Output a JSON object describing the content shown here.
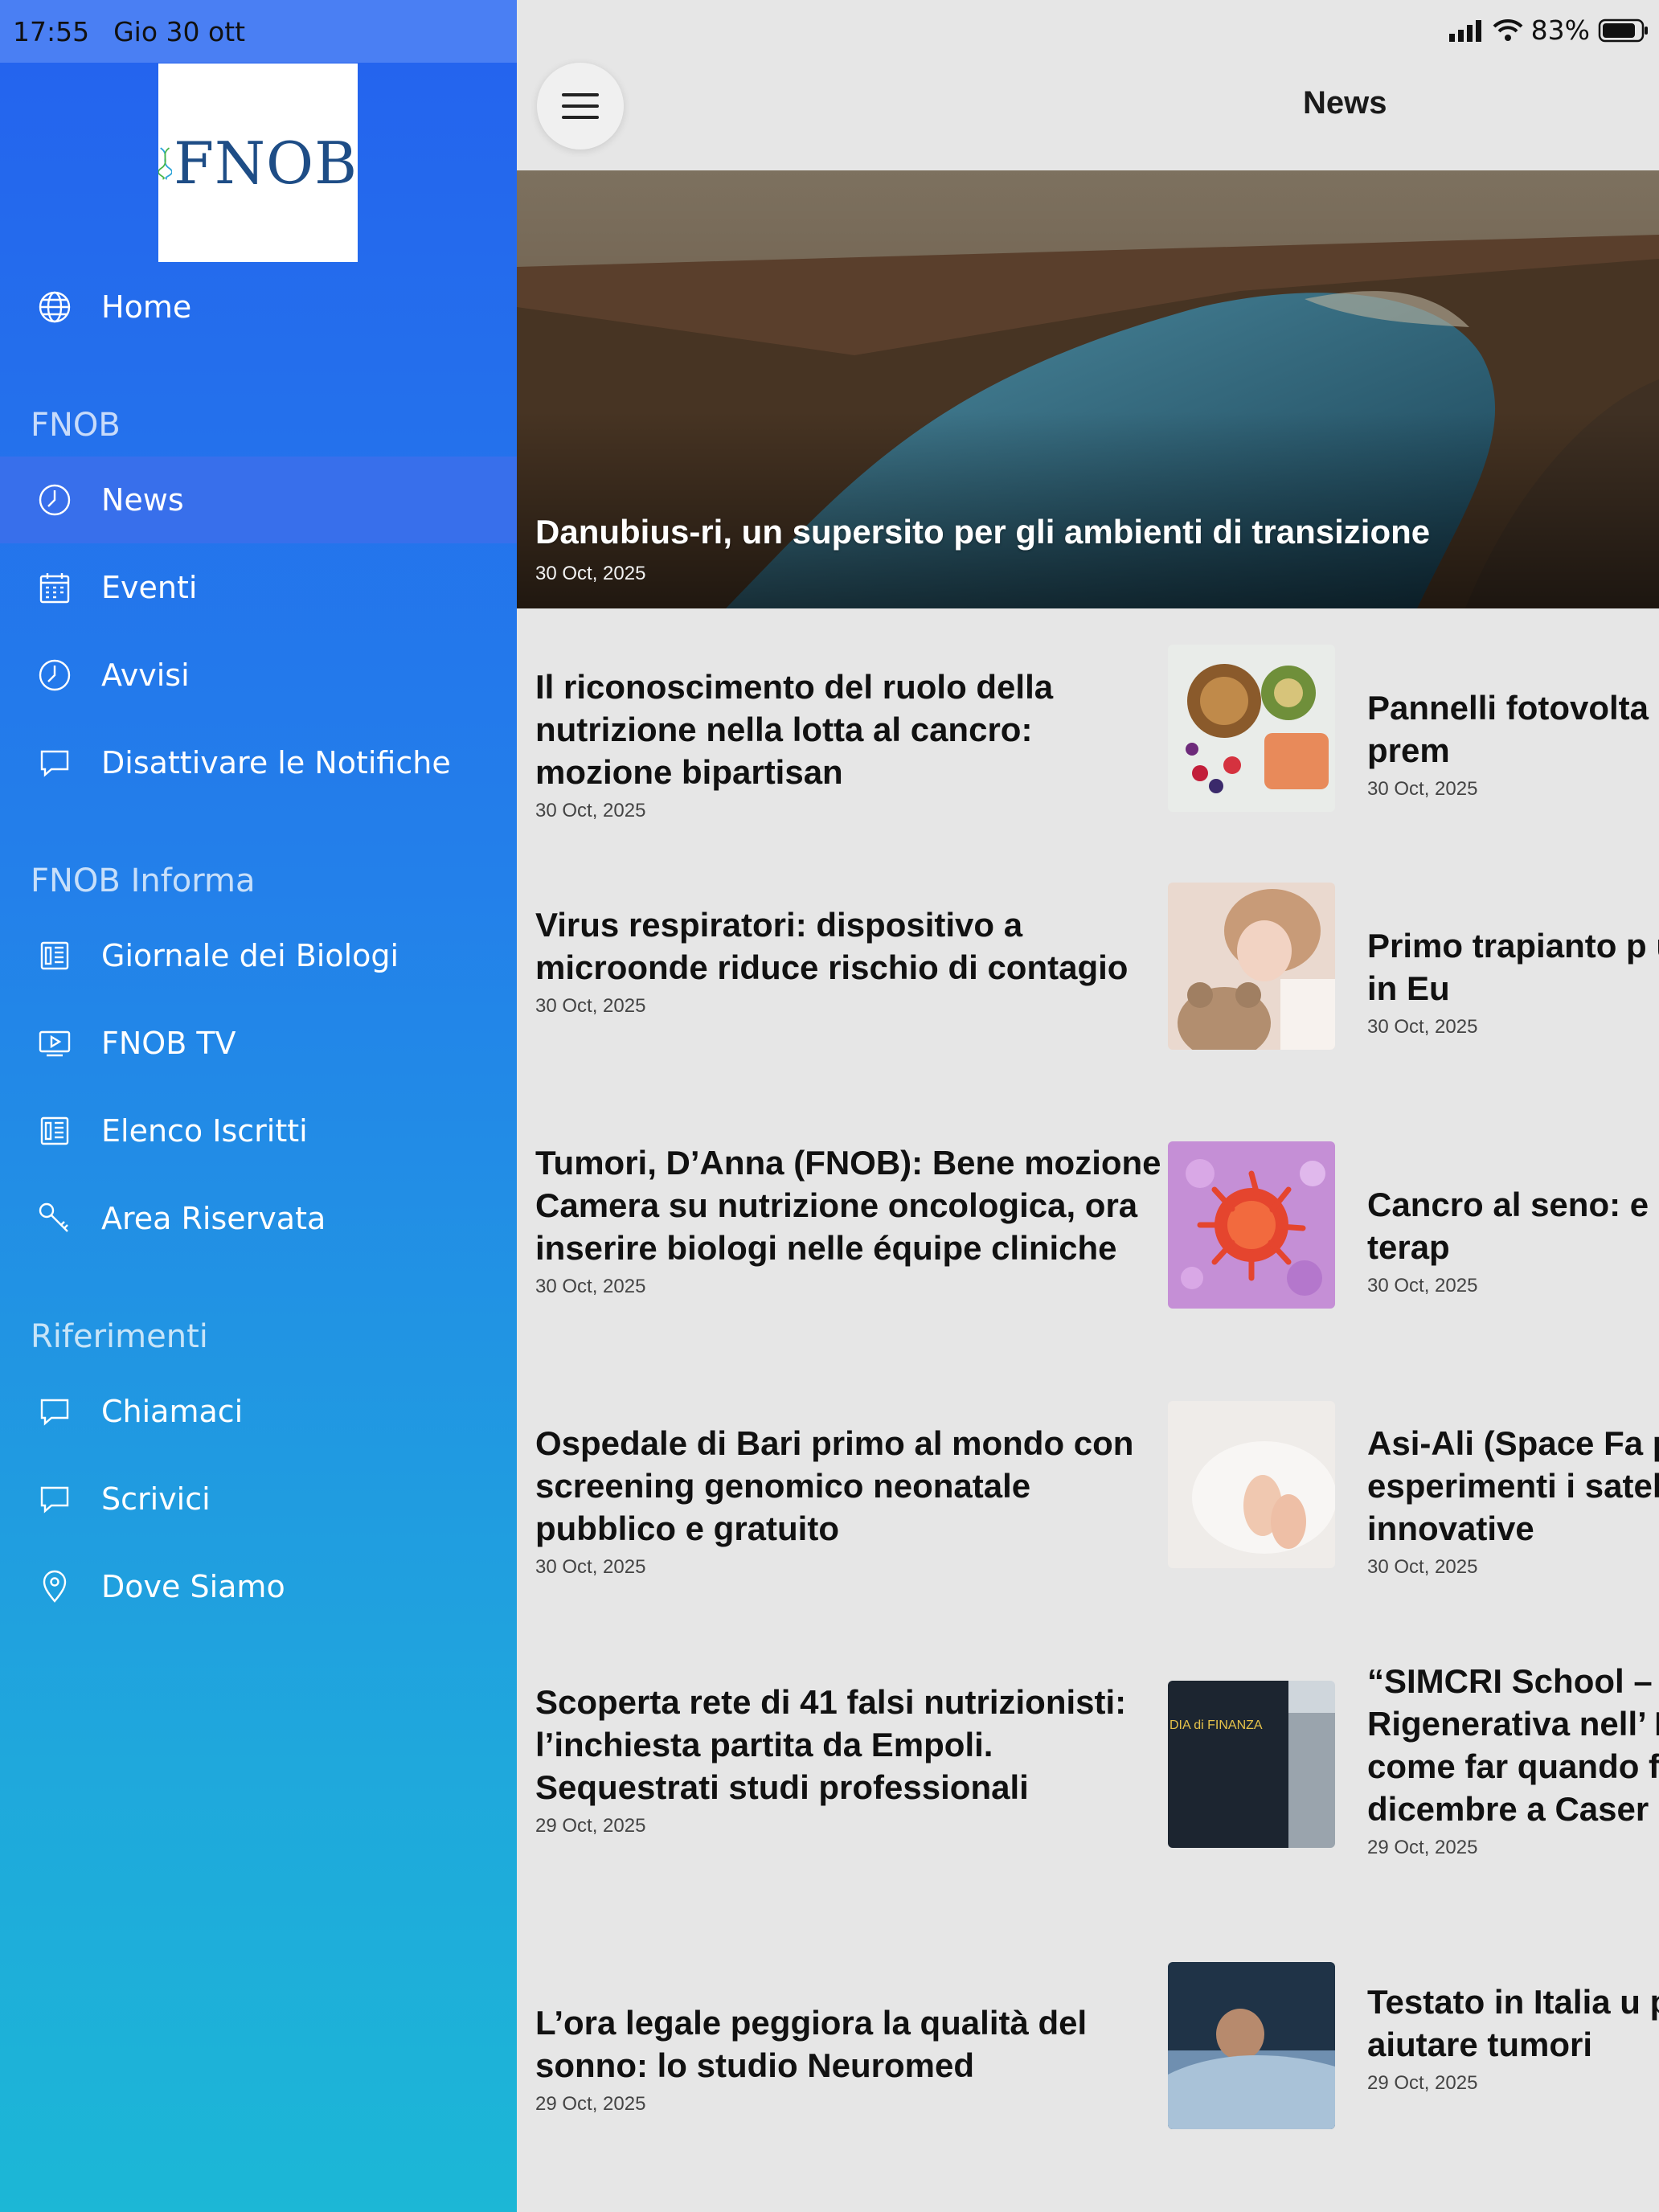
{
  "status": {
    "time": "17:55",
    "date": "Gio 30 ott",
    "battery": "83%"
  },
  "brand": {
    "logo_text": "FNOB"
  },
  "sidebar": {
    "home": "Home",
    "sections": [
      {
        "header": "FNOB",
        "items": [
          {
            "label": "News",
            "icon": "clock-icon",
            "active": true
          },
          {
            "label": "Eventi",
            "icon": "calendar-icon"
          },
          {
            "label": "Avvisi",
            "icon": "clock-icon"
          },
          {
            "label": "Disattivare le Notifiche",
            "icon": "chat-bubble-icon"
          }
        ]
      },
      {
        "header": "FNOB Informa",
        "items": [
          {
            "label": "Giornale dei Biologi",
            "icon": "newspaper-icon"
          },
          {
            "label": "FNOB TV",
            "icon": "tv-icon"
          },
          {
            "label": "Elenco Iscritti",
            "icon": "newspaper-icon"
          },
          {
            "label": "Area Riservata",
            "icon": "key-icon"
          }
        ]
      },
      {
        "header": "Riferimenti",
        "items": [
          {
            "label": "Chiamaci",
            "icon": "chat-bubble-icon"
          },
          {
            "label": "Scrivici",
            "icon": "chat-bubble-icon"
          },
          {
            "label": "Dove Siamo",
            "icon": "location-pin-icon"
          }
        ]
      }
    ]
  },
  "header": {
    "title": "News"
  },
  "hero": {
    "title": "Danubius-ri, un supersito per gli ambienti di transizione",
    "date": "30 Oct, 2025"
  },
  "articles_left": [
    {
      "title": "Il riconoscimento del ruolo della nutrizione nella lotta al cancro: mozione bipartisan",
      "date": "30 Oct, 2025"
    },
    {
      "title": "Virus respiratori: dispositivo a microonde riduce rischio di contagio",
      "date": "30 Oct, 2025"
    },
    {
      "title": "Tumori, D’Anna (FNOB): Bene mozione Camera su nutrizione oncologica, ora inserire biologi nelle équipe cliniche",
      "date": "30 Oct, 2025"
    },
    {
      "title": "Ospedale di Bari primo al mondo con screening genomico neonatale pubblico e gratuito",
      "date": "30 Oct, 2025"
    },
    {
      "title": "Scoperta rete di 41 falsi nutrizionisti: l’inchiesta partita da Empoli. Sequestrati studi professionali",
      "date": "29 Oct, 2025"
    },
    {
      "title": "L’ora legale peggiora la qualità del sonno: lo studio Neuromed",
      "date": "29 Oct, 2025"
    }
  ],
  "articles_right": [
    {
      "title": "Pannelli fotovolta candidati al prem",
      "date": "30 Oct, 2025"
    },
    {
      "title": "Primo trapianto p un bambino in Eu",
      "date": "30 Oct, 2025"
    },
    {
      "title": "Cancro al seno: e indebolisce terap",
      "date": "30 Oct, 2025"
    },
    {
      "title": "Asi-Ali (Space Fa per esperimenti i satelliti innovative",
      "date": "30 Oct, 2025"
    },
    {
      "title": "“SIMCRI School – Rigenerativa nell’ Medico: come far quando fare” – Ev dicembre a Caser",
      "date": "29 Oct, 2025"
    },
    {
      "title": "Testato in Italia u potrebbe aiutare tumori",
      "date": "29 Oct, 2025"
    }
  ],
  "thumb_texts": {
    "finanza": "DIA di FINANZA"
  }
}
